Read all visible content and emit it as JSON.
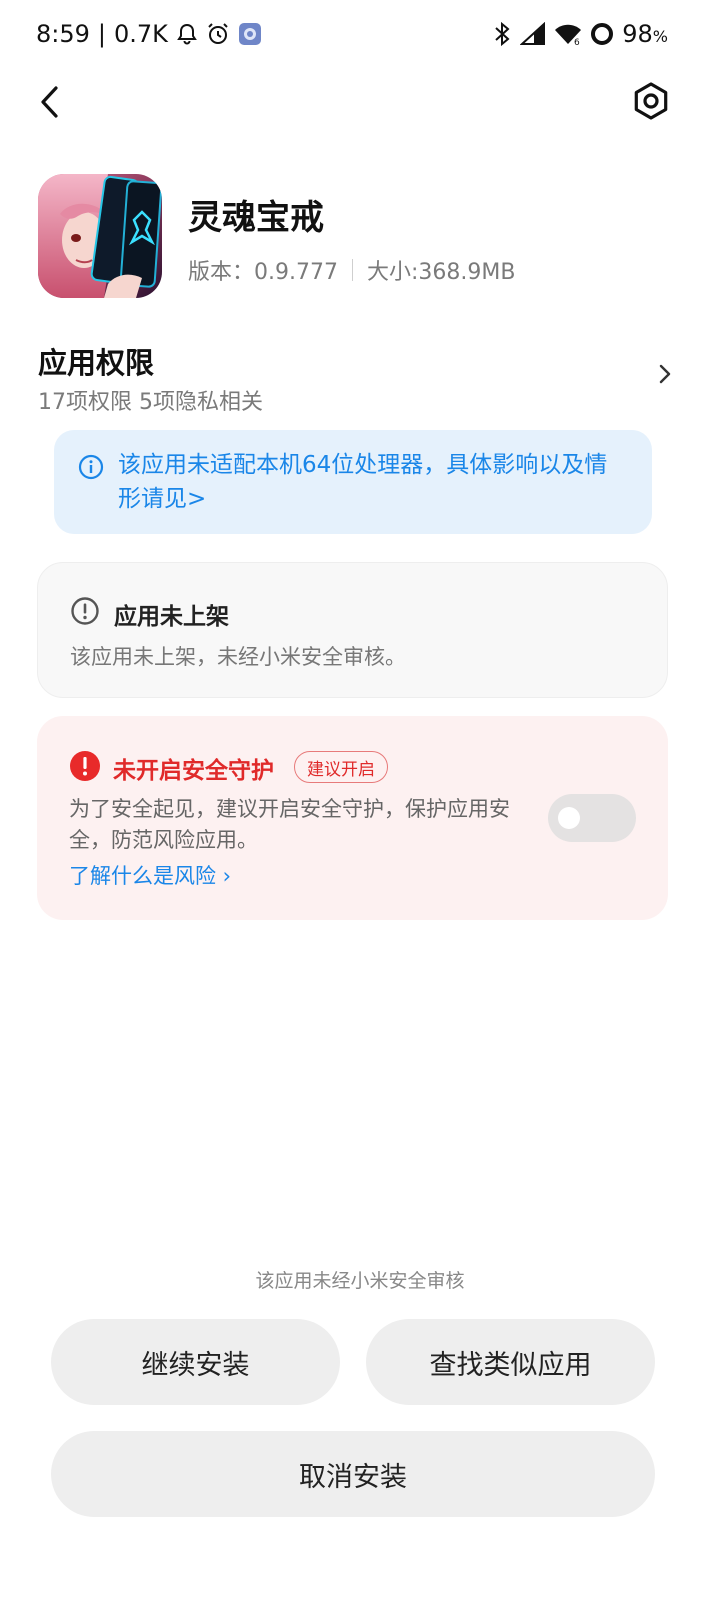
{
  "status_bar": {
    "time": "8:59",
    "separator": "|",
    "data_speed": "0.7K",
    "battery_value": "98",
    "battery_unit": "%",
    "icons": [
      "notification-bell-icon",
      "alarm-clock-icon",
      "app-notification-icon",
      "bluetooth-icon",
      "cellular-signal-icon",
      "wifi-icon",
      "battery-ring-icon"
    ]
  },
  "app": {
    "name": "灵魂宝戒",
    "version_text": "版本：0.9.777",
    "size_text": "大小:368.9MB"
  },
  "permissions": {
    "title": "应用权限",
    "subtitle": "17项权限 5项隐私相关"
  },
  "info_notice": {
    "text": "该应用未适配本机64位处理器，具体影响以及情形请见>",
    "color": "#1a86e8"
  },
  "unlisted": {
    "title": "应用未上架",
    "description": "该应用未上架，未经小米安全审核。"
  },
  "security": {
    "title": "未开启安全守护",
    "badge": "建议开启",
    "description": "为了安全起见，建议开启安全守护，保护应用安全，防范风险应用。",
    "link": "了解什么是风险 ›",
    "toggle_on": false,
    "accent_color": "#e02a2a"
  },
  "footer": {
    "note": "该应用未经小米安全审核",
    "continue_label": "继续安装",
    "similar_label": "查找类似应用",
    "cancel_label": "取消安装"
  }
}
